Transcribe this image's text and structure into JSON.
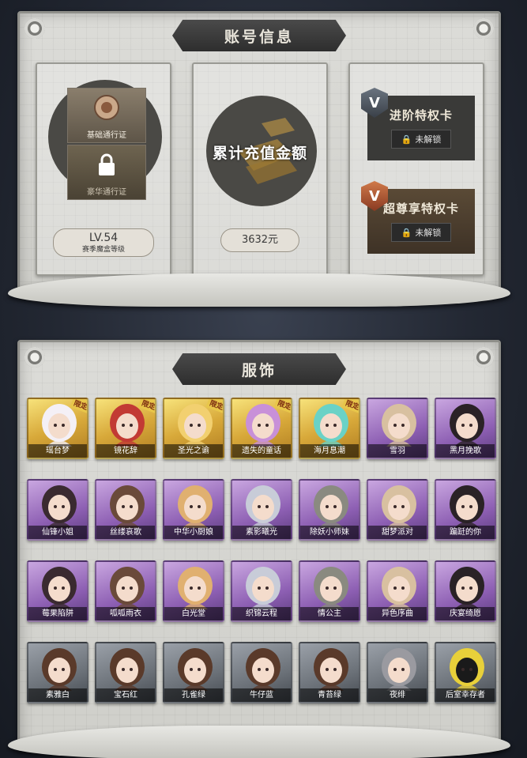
{
  "account": {
    "title": "账号信息",
    "basic_pass": "基础通行证",
    "luxury_pass": "豪华通行证",
    "level_value": "LV.54",
    "level_caption": "赛季魔盒等级",
    "recharge_title": "累计充值金额",
    "recharge_value": "3632元",
    "advanced_card": "进阶特权卡",
    "premium_card": "超尊享特权卡",
    "locked_label": "未解锁"
  },
  "costume": {
    "title": "服饰",
    "tag_limited": "限定",
    "items": [
      {
        "name": "瑶台梦",
        "tier": "gold",
        "tag": "限定"
      },
      {
        "name": "镜花辞",
        "tier": "gold",
        "tag": "限定"
      },
      {
        "name": "圣光之谕",
        "tier": "gold",
        "tag": "限定"
      },
      {
        "name": "遗失的童话",
        "tier": "gold",
        "tag": "限定"
      },
      {
        "name": "海月息潮",
        "tier": "gold",
        "tag": "限定"
      },
      {
        "name": "雪羽",
        "tier": "purple",
        "tag": ""
      },
      {
        "name": "黑月挽歌",
        "tier": "purple",
        "tag": ""
      },
      {
        "name": "仙锋小姐",
        "tier": "purple",
        "tag": ""
      },
      {
        "name": "丝缕哀歌",
        "tier": "purple",
        "tag": ""
      },
      {
        "name": "中华小厨娘",
        "tier": "purple",
        "tag": ""
      },
      {
        "name": "素影曦光",
        "tier": "purple",
        "tag": ""
      },
      {
        "name": "除妖小师妹",
        "tier": "purple",
        "tag": ""
      },
      {
        "name": "甜梦派对",
        "tier": "purple",
        "tag": ""
      },
      {
        "name": "蹁跹的你",
        "tier": "purple",
        "tag": ""
      },
      {
        "name": "莓果陷阱",
        "tier": "purple",
        "tag": ""
      },
      {
        "name": "呱呱雨衣",
        "tier": "purple",
        "tag": ""
      },
      {
        "name": "白光堂",
        "tier": "purple",
        "tag": ""
      },
      {
        "name": "织锦云程",
        "tier": "purple",
        "tag": ""
      },
      {
        "name": "情公主",
        "tier": "purple",
        "tag": ""
      },
      {
        "name": "异色序曲",
        "tier": "purple",
        "tag": ""
      },
      {
        "name": "庆宴绮愿",
        "tier": "purple",
        "tag": ""
      },
      {
        "name": "素雅白",
        "tier": "gray",
        "tag": ""
      },
      {
        "name": "宝石红",
        "tier": "gray",
        "tag": ""
      },
      {
        "name": "孔雀绿",
        "tier": "gray",
        "tag": ""
      },
      {
        "name": "牛仔蓝",
        "tier": "gray",
        "tag": ""
      },
      {
        "name": "青苔绿",
        "tier": "gray",
        "tag": ""
      },
      {
        "name": "夜绯",
        "tier": "gray",
        "tag": ""
      },
      {
        "name": "后室幸存者",
        "tier": "gray",
        "tag": ""
      }
    ]
  },
  "colors": {
    "gold_tier": "#d8a93a",
    "purple_tier": "#8d5fb3",
    "gray_tier": "#6b7178",
    "banner": "#3a3a3a",
    "card_dark": "#3a3a38"
  }
}
